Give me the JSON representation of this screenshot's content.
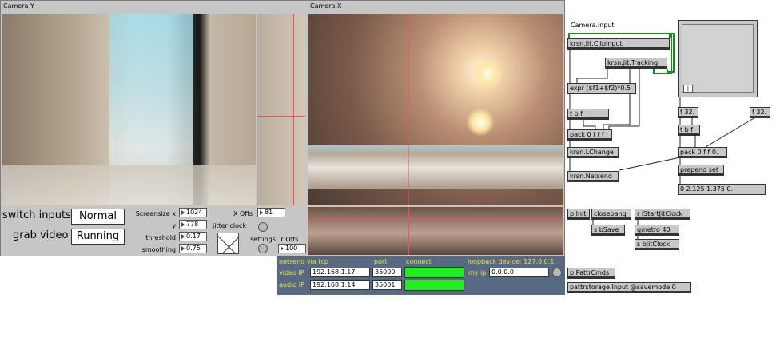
{
  "cameras": {
    "y_title": "Camera Y",
    "x_title": "Camera X"
  },
  "controls": {
    "switch_inputs_label": "switch inputs",
    "switch_inputs_value": "Normal",
    "grab_video_label": "grab video",
    "grab_video_value": "Running",
    "screensize_x_label": "Screensize x",
    "screensize_x_value": "1024",
    "y_label": "y",
    "y_value": "778",
    "threshold_label": "threshold",
    "threshold_value": "0.17",
    "smoothing_label": "smoothing",
    "smoothing_value": "0.75",
    "x_offs_label": "X Offs",
    "x_offs_value": "81",
    "jitter_clock_label": "jitter clock",
    "settings_label": "settings",
    "y_offs_label": "Y Offs",
    "y_offs_value": "100"
  },
  "netsend": {
    "title": "netsend via tcp",
    "port_label": "port",
    "connect_label": "connect",
    "loopback_label": "loopback device: 127.0.0.1",
    "video_ip_label": "video IP",
    "video_ip_value": "192.168.1.17",
    "video_port_value": "35000",
    "audio_ip_label": "audio IP",
    "audio_ip_value": "192.168.1.14",
    "audio_port_value": "35001",
    "my_ip_label": "my ip",
    "my_ip_value": "0.0.0.0"
  },
  "patch": {
    "camera_input_comment": "Camera.input",
    "clipinput": "krsn.jit.ClipInput",
    "tracking": "krsn.jit.Tracking",
    "expr": "expr ($f1+$f2)*0.5",
    "tbf1": "t b f",
    "pack1": "pack 0 f f f",
    "lchange": "krsn.LChange",
    "netsend_obj": "krsn.Netsend",
    "f32a": "f 32.",
    "f32b": "f 32.",
    "tbf2": "t b f",
    "pack2": "pack 0 f f 0.",
    "prepend": "prepend set",
    "message": "0 2.125 1.375 0.",
    "p_init": "p Init",
    "closebang": "closebang",
    "rstart": "r iStartJitClock",
    "s_bsave": "s bSave",
    "qmetro": "qmetro 40",
    "s_bjit": "s bJitClock",
    "p_pattr": "p PattrCmds",
    "pattrstorage": "pattrstorage Input @savemode 0"
  },
  "colors": {
    "panel": "#c6c6c6",
    "netsend_bg": "#566a83",
    "netsend_text": "#f0e040",
    "connect_green": "#1ef01e",
    "patch_cord_green": "#1a8a1a"
  }
}
